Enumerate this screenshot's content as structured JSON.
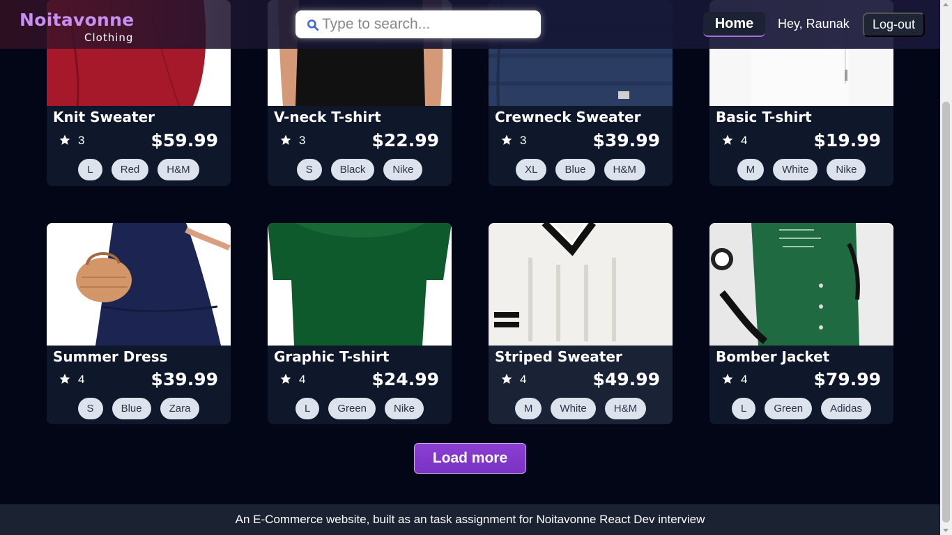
{
  "brand": {
    "name": "Noitavonne",
    "subtitle": "Clothing",
    "accent": "#c690f2"
  },
  "search": {
    "placeholder": "Type to search...",
    "value": "",
    "icon": "search-icon"
  },
  "nav": {
    "home": "Home",
    "greeting": "Hey, Raunak",
    "logout": "Log-out"
  },
  "products": [
    {
      "name": "Knit Sweater",
      "rating": "3",
      "price": "$59.99",
      "size": "L",
      "color": "Red",
      "brand": "H&M"
    },
    {
      "name": "V-neck T-shirt",
      "rating": "3",
      "price": "$22.99",
      "size": "S",
      "color": "Black",
      "brand": "Nike"
    },
    {
      "name": "Crewneck Sweater",
      "rating": "3",
      "price": "$39.99",
      "size": "XL",
      "color": "Blue",
      "brand": "H&M"
    },
    {
      "name": "Basic T-shirt",
      "rating": "4",
      "price": "$19.99",
      "size": "M",
      "color": "White",
      "brand": "Nike"
    },
    {
      "name": "Summer Dress",
      "rating": "4",
      "price": "$39.99",
      "size": "S",
      "color": "Blue",
      "brand": "Zara"
    },
    {
      "name": "Graphic T-shirt",
      "rating": "4",
      "price": "$24.99",
      "size": "L",
      "color": "Green",
      "brand": "Nike"
    },
    {
      "name": "Striped Sweater",
      "rating": "4",
      "price": "$49.99",
      "size": "M",
      "color": "White",
      "brand": "H&M"
    },
    {
      "name": "Bomber Jacket",
      "rating": "4",
      "price": "$79.99",
      "size": "L",
      "color": "Green",
      "brand": "Adidas"
    }
  ],
  "load_more": "Load more",
  "footer": {
    "text": "An E-Commerce website, built as an task assignment for Noitavonne React Dev interview"
  },
  "colors": {
    "background": "#030617",
    "card": "#0f172a",
    "tag": "#dde3ec",
    "button": "#8a3fd1"
  }
}
